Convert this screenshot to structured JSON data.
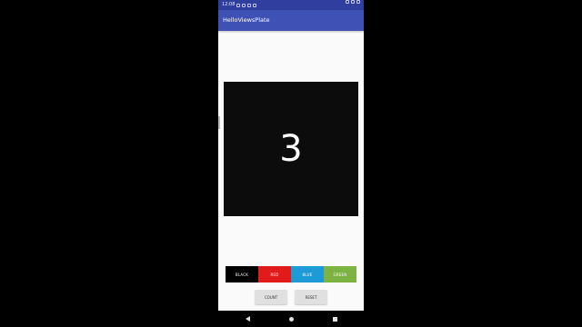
{
  "status_bar": {
    "time": "12:08"
  },
  "app_bar": {
    "title": "HelloViewsPlate"
  },
  "display": {
    "value": "3"
  },
  "color_buttons": [
    {
      "label": "BLACK",
      "color": "#000000"
    },
    {
      "label": "RED",
      "color": "#e11a1a"
    },
    {
      "label": "BLUE",
      "color": "#1e9ad6"
    },
    {
      "label": "GREEN",
      "color": "#7cb342"
    }
  ],
  "actions": {
    "count_label": "COUNT",
    "reset_label": "RESET"
  },
  "colors": {
    "status_bar": "#303f9f",
    "app_bar": "#3f51b5",
    "display_bg": "#0c0c0c"
  }
}
